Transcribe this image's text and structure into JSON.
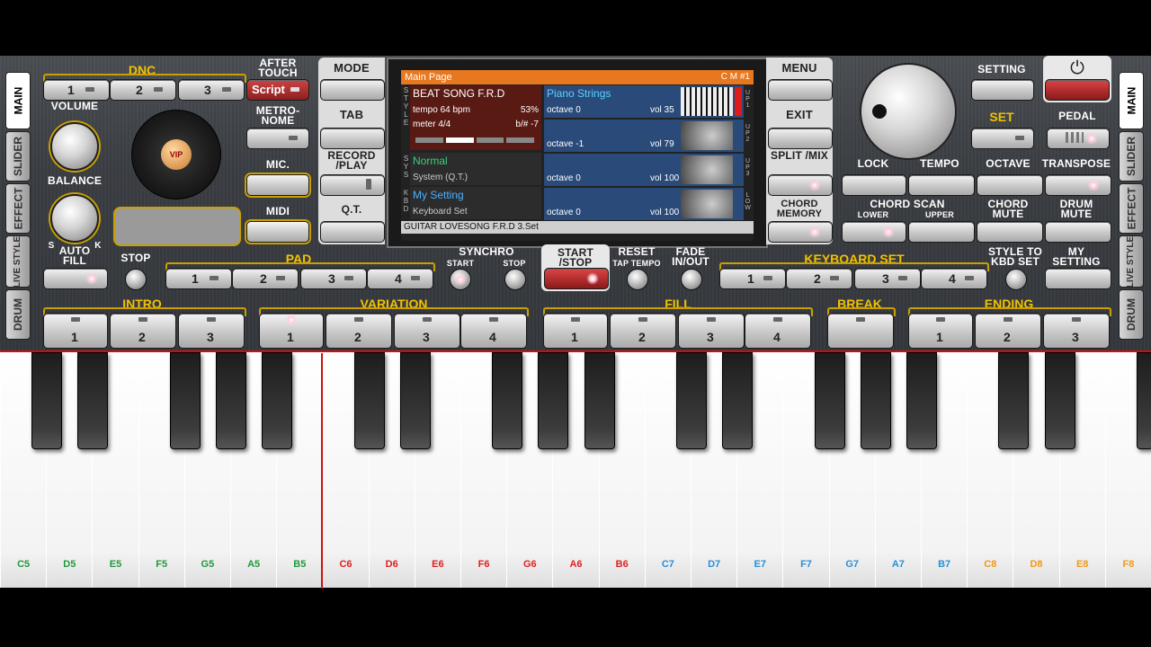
{
  "side_tabs_left": [
    "MAIN",
    "SLIDER",
    "EFFECT",
    "LIVE STYLE",
    "DRUM"
  ],
  "side_tabs_right": [
    "MAIN",
    "SLIDER",
    "EFFECT",
    "LIVE STYLE",
    "DRUM"
  ],
  "dnc": {
    "label": "DNC",
    "buttons": [
      "1",
      "2",
      "3"
    ]
  },
  "after_touch": {
    "label": "AFTER TOUCH",
    "value": "Script"
  },
  "volume_label": "VOLUME",
  "balance_label": "BALANCE",
  "balance_s": "S",
  "balance_k": "K",
  "vip_label": "VIP",
  "metronome_label": "METRO- NOME",
  "mic_label": "MIC.",
  "midi_label": "MIDI",
  "mode_label": "MODE",
  "tab_label": "TAB",
  "record_play_label": "RECORD /PLAY",
  "qt_label": "Q.T.",
  "menu_label": "MENU",
  "exit_label": "EXIT",
  "split_mix_label": "SPLIT /MIX",
  "chord_memory_label": "CHORD MEMORY",
  "setting_label": "SETTING",
  "set_label": "SET",
  "pedal_label": "PEDAL",
  "lock_label": "LOCK",
  "tempo_label": "TEMPO",
  "octave_label": "OCTAVE",
  "transpose_label": "TRANSPOSE",
  "chord_scan_label": "CHORD SCAN",
  "lower_label": "LOWER",
  "upper_label": "UPPER",
  "chord_mute_label": "CHORD MUTE",
  "drum_mute_label": "DRUM MUTE",
  "screen": {
    "title": "Main Page",
    "cm": "C M #1",
    "style_name": "BEAT SONG F.R.D",
    "tempo": "tempo 64 bpm",
    "percent": "53%",
    "meter": "meter 4/4",
    "bsharp": "b/# -7",
    "sys_name": "Normal",
    "sys_sub": "System (Q.T.)",
    "kbd_name": "My Setting",
    "kbd_sub": "Keyboard Set",
    "voices": [
      {
        "name": "Piano Strings",
        "octave": "octave  0",
        "vol": "vol 35",
        "tag": "UP1"
      },
      {
        "name": "",
        "octave": "octave -1",
        "vol": "vol 79",
        "tag": "UP2"
      },
      {
        "name": "",
        "octave": "octave  0",
        "vol": "vol 100",
        "tag": "UP3"
      },
      {
        "name": "",
        "octave": "octave  0",
        "vol": "vol 100",
        "tag": "LOW"
      }
    ],
    "side_style": "STYLE",
    "side_sys": "SYS",
    "side_kbd": "KBD",
    "footer": "GUITAR LOVESONG F.R.D 3.Set"
  },
  "auto_fill_label": "AUTO FILL",
  "stop_label": "STOP",
  "pad": {
    "label": "PAD",
    "buttons": [
      "1",
      "2",
      "3",
      "4"
    ]
  },
  "synchro": {
    "label": "SYNCHRO",
    "start": "START",
    "stop": "STOP"
  },
  "start_stop_label": "START /STOP",
  "reset_label": "RESET",
  "tap_tempo_label": "TAP TEMPO",
  "fade_label": "FADE IN/OUT",
  "keyboard_set": {
    "label": "KEYBOARD SET",
    "buttons": [
      "1",
      "2",
      "3",
      "4"
    ]
  },
  "style_to_kbd_label": "STYLE TO KBD SET",
  "my_setting_label": "MY SETTING",
  "intro": {
    "label": "INTRO",
    "buttons": [
      "1",
      "2",
      "3"
    ]
  },
  "variation": {
    "label": "VARIATION",
    "buttons": [
      "1",
      "2",
      "3",
      "4"
    ]
  },
  "fill": {
    "label": "FILL",
    "buttons": [
      "1",
      "2",
      "3",
      "4"
    ]
  },
  "break_label": "BREAK",
  "ending": {
    "label": "ENDING",
    "buttons": [
      "1",
      "2",
      "3"
    ]
  },
  "keys": [
    {
      "note": "C5",
      "color": "#1f9a3a"
    },
    {
      "note": "D5",
      "color": "#1f9a3a"
    },
    {
      "note": "E5",
      "color": "#1f9a3a"
    },
    {
      "note": "F5",
      "color": "#1f9a3a"
    },
    {
      "note": "G5",
      "color": "#1f9a3a"
    },
    {
      "note": "A5",
      "color": "#1f9a3a"
    },
    {
      "note": "B5",
      "color": "#1f9a3a"
    },
    {
      "note": "C6",
      "color": "#e02020"
    },
    {
      "note": "D6",
      "color": "#e02020"
    },
    {
      "note": "E6",
      "color": "#e02020"
    },
    {
      "note": "F6",
      "color": "#e02020"
    },
    {
      "note": "G6",
      "color": "#e02020"
    },
    {
      "note": "A6",
      "color": "#e02020"
    },
    {
      "note": "B6",
      "color": "#e02020"
    },
    {
      "note": "C7",
      "color": "#2a8fd8"
    },
    {
      "note": "D7",
      "color": "#2a8fd8"
    },
    {
      "note": "E7",
      "color": "#2a8fd8"
    },
    {
      "note": "F7",
      "color": "#2a8fd8"
    },
    {
      "note": "G7",
      "color": "#2a8fd8"
    },
    {
      "note": "A7",
      "color": "#2a8fd8"
    },
    {
      "note": "B7",
      "color": "#2a8fd8"
    },
    {
      "note": "C8",
      "color": "#f29a14"
    },
    {
      "note": "D8",
      "color": "#f29a14"
    },
    {
      "note": "E8",
      "color": "#f29a14"
    },
    {
      "note": "F8",
      "color": "#f29a14"
    }
  ]
}
